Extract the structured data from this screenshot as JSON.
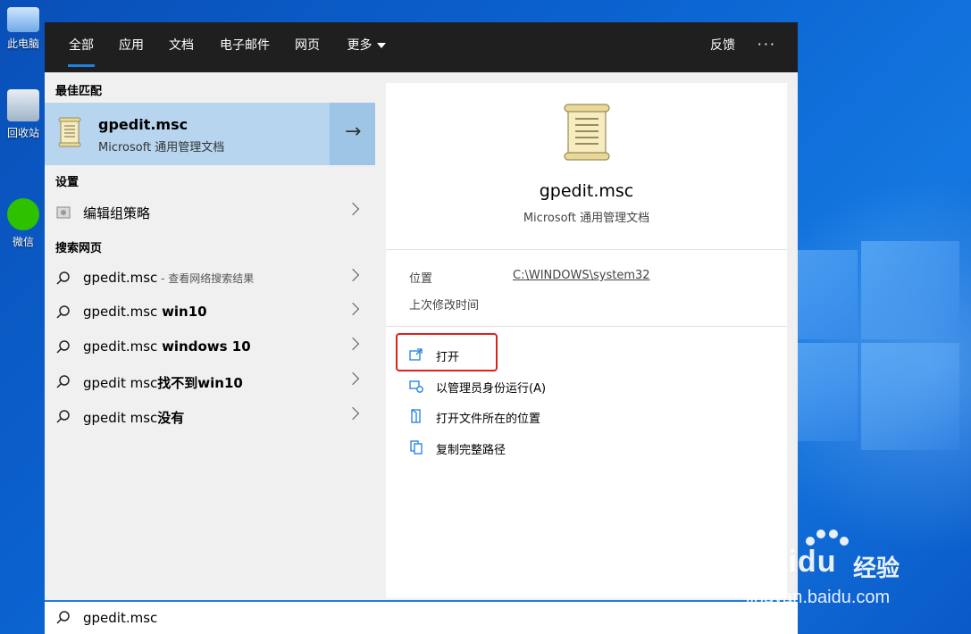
{
  "desktop": {
    "icons": [
      {
        "label": "此电脑"
      },
      {
        "label": "回收站"
      },
      {
        "label": "微信"
      }
    ]
  },
  "tabs": [
    {
      "label": "全部",
      "active": true
    },
    {
      "label": "应用"
    },
    {
      "label": "文档"
    },
    {
      "label": "电子邮件"
    },
    {
      "label": "网页"
    },
    {
      "label": "更多"
    }
  ],
  "header": {
    "feedback": "反馈",
    "more_options": "···"
  },
  "best_match": {
    "section": "最佳匹配",
    "title": "gpedit.msc",
    "subtitle": "Microsoft 通用管理文档",
    "arrow": "→"
  },
  "settings": {
    "section": "设置",
    "item": "编辑组策略"
  },
  "web": {
    "section": "搜索网页",
    "items": [
      {
        "text": "gpedit.msc",
        "bold": "",
        "hint": " - 查看网络搜索结果"
      },
      {
        "text": "gpedit.msc ",
        "bold": "win10",
        "hint": ""
      },
      {
        "text": "gpedit.msc ",
        "bold": "windows 10",
        "hint": ""
      },
      {
        "text": "gpedit msc",
        "bold": "找不到win10",
        "hint": ""
      },
      {
        "text": "gpedit msc",
        "bold": "没有",
        "hint": ""
      }
    ]
  },
  "detail": {
    "title": "gpedit.msc",
    "subtitle": "Microsoft 通用管理文档",
    "location_label": "位置",
    "location_value": "C:\\WINDOWS\\system32",
    "modified_label": "上次修改时间",
    "actions": [
      {
        "label": "打开",
        "icon": "open-icon"
      },
      {
        "label": "以管理员身份运行(A)",
        "icon": "run-as-admin-icon"
      },
      {
        "label": "打开文件所在的位置",
        "icon": "folder-location-icon"
      },
      {
        "label": "复制完整路径",
        "icon": "copy-path-icon"
      }
    ]
  },
  "search": {
    "value": "gpedit.msc"
  },
  "watermark": {
    "brand": "Bai",
    "brand2": "du",
    "cn": "经验",
    "url": "jingyan.baidu.com"
  },
  "colors": {
    "accent": "#1e80e0",
    "highlight": "#e0201a",
    "selected": "#b7d5ef",
    "tabbar": "#1f1f1f"
  }
}
